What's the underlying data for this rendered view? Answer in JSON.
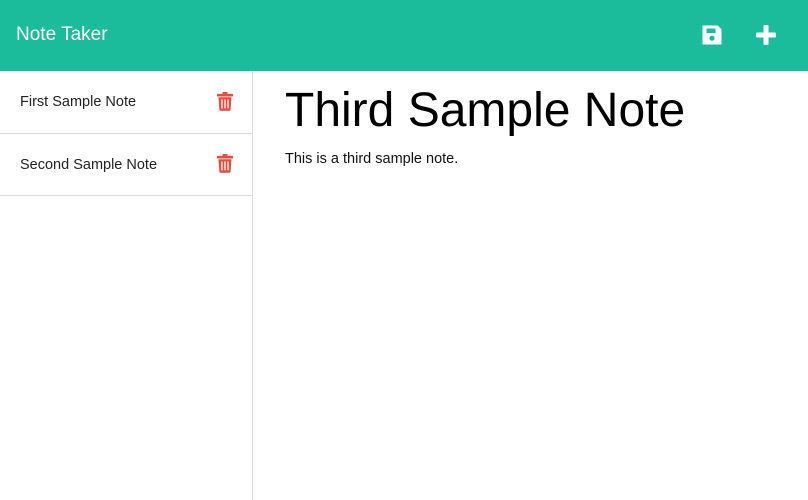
{
  "app": {
    "brand": "Note Taker",
    "accent_color": "#1abc9c",
    "delete_color": "#e74c3c"
  },
  "navbar": {
    "icons": [
      "save-icon",
      "plus-icon"
    ]
  },
  "sidebar": {
    "notes": [
      {
        "title": "First Sample Note",
        "icon": "trash-icon"
      },
      {
        "title": "Second Sample Note",
        "icon": "trash-icon"
      }
    ]
  },
  "main": {
    "title": "Third Sample Note",
    "body": "This is a third sample note."
  }
}
